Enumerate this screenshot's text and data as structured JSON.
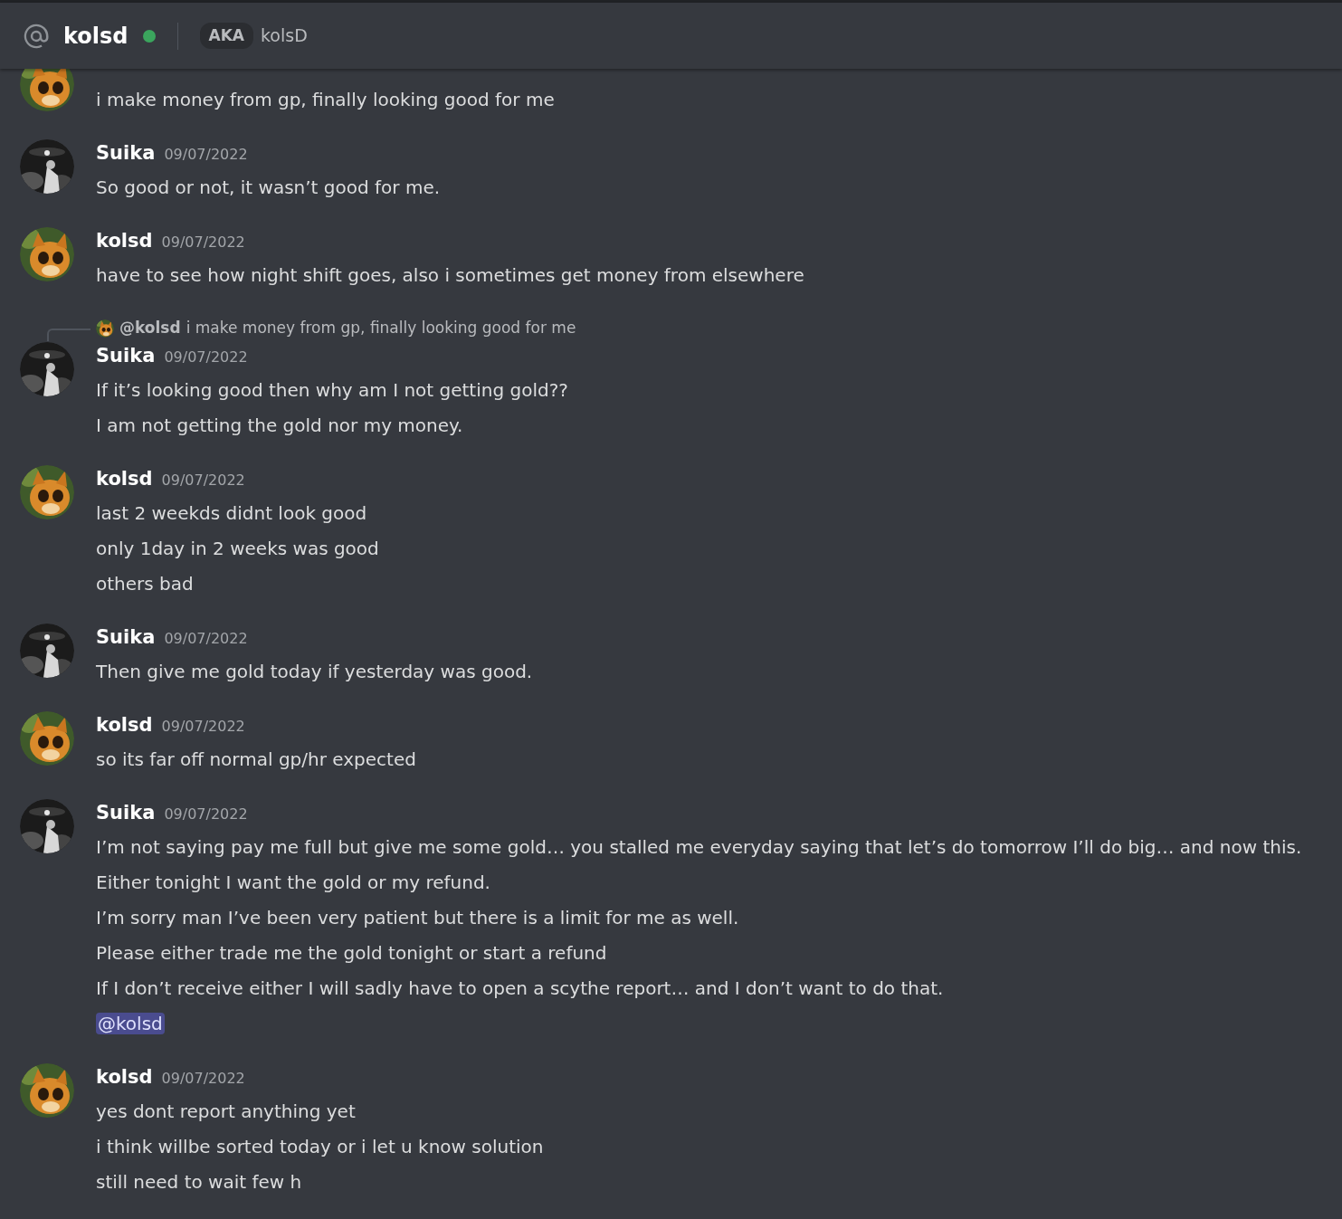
{
  "header": {
    "channel": "kolsd",
    "online": true,
    "aka_label": "AKA",
    "aka_name": "kolsD"
  },
  "messages": [
    {
      "lines": [
        {
          "kind": "text",
          "text": "i make money from gp, finally looking good for me"
        }
      ]
    },
    {
      "author": "Suika",
      "time": "09/07/2022",
      "lines": [
        {
          "kind": "text",
          "text": "So good or not, it wasn’t good for me."
        }
      ]
    },
    {
      "author": "kolsd",
      "time": "09/07/2022",
      "lines": [
        {
          "kind": "text",
          "text": "have to see how night shift goes, also i sometimes get money from elsewhere"
        }
      ]
    },
    {
      "author": "Suika",
      "time": "09/07/2022",
      "reply": {
        "author": "@kolsd",
        "text": "i make money from gp, finally looking good for me"
      },
      "lines": [
        {
          "kind": "text",
          "text": "If it’s looking good then why am I not getting gold??"
        },
        {
          "kind": "text",
          "text": "I am not getting the gold nor my money."
        }
      ]
    },
    {
      "author": "kolsd",
      "time": "09/07/2022",
      "lines": [
        {
          "kind": "text",
          "text": "last 2 weekds didnt look good"
        },
        {
          "kind": "text",
          "text": "only 1day in 2 weeks was good"
        },
        {
          "kind": "text",
          "text": "others bad"
        }
      ]
    },
    {
      "author": "Suika",
      "time": "09/07/2022",
      "lines": [
        {
          "kind": "text",
          "text": "Then give me gold today if yesterday was good."
        }
      ]
    },
    {
      "author": "kolsd",
      "time": "09/07/2022",
      "lines": [
        {
          "kind": "text",
          "text": "so its far off normal gp/hr expected"
        }
      ]
    },
    {
      "author": "Suika",
      "time": "09/07/2022",
      "lines": [
        {
          "kind": "text",
          "text": "I’m not saying pay me full but give me some gold… you stalled me everyday saying that let’s do tomorrow I’ll do big… and now this."
        },
        {
          "kind": "text",
          "text": "Either tonight I want the gold or my refund."
        },
        {
          "kind": "text",
          "text": "I’m sorry man I’ve been very patient but there is a limit for me as well."
        },
        {
          "kind": "text",
          "text": "Please either trade me the gold tonight or start a refund"
        },
        {
          "kind": "text",
          "text": "If I don’t receive either I will sadly have to open a scythe report… and I don’t want to do that."
        },
        {
          "kind": "mention",
          "text": "@kolsd"
        }
      ]
    },
    {
      "author": "kolsd",
      "time": "09/07/2022",
      "lines": [
        {
          "kind": "text",
          "text": "yes dont report anything yet"
        },
        {
          "kind": "text",
          "text": "i think willbe sorted today or i let u know solution"
        },
        {
          "kind": "text",
          "text": "still need to wait few h"
        }
      ]
    }
  ]
}
